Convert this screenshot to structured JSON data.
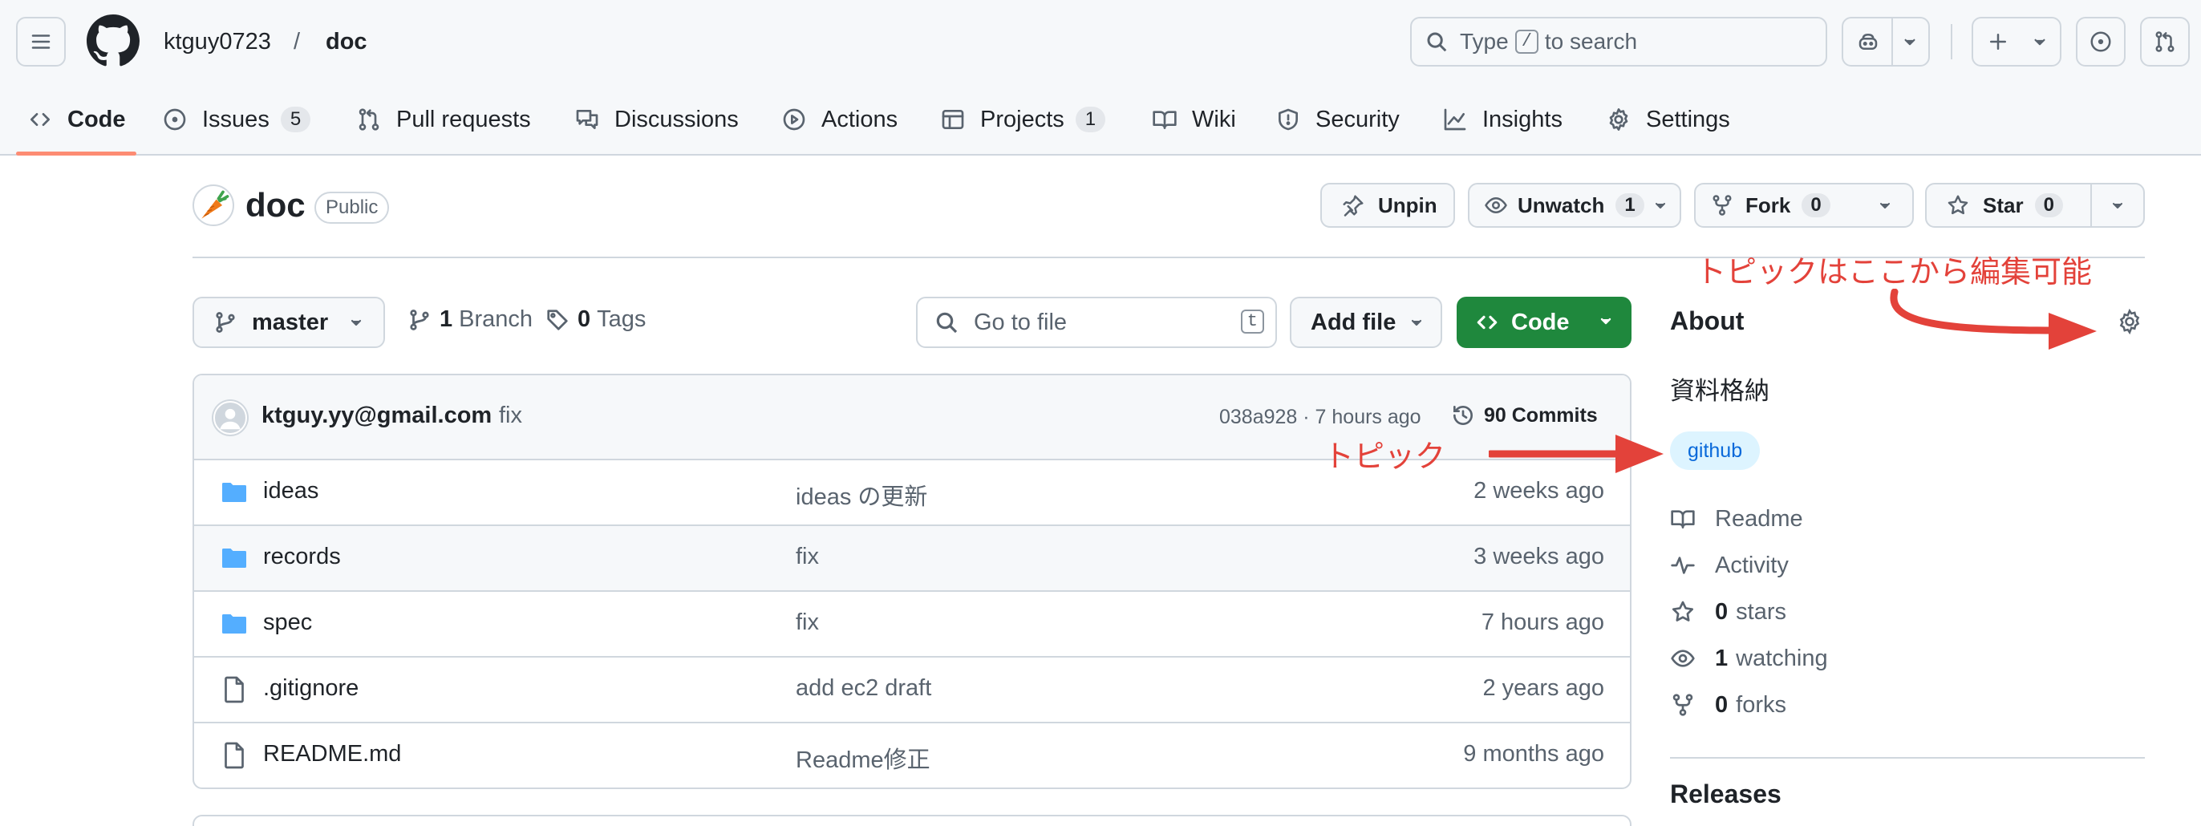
{
  "header": {
    "owner": "ktguy0723",
    "separator": "/",
    "repo": "doc",
    "search_prefix": "Type",
    "search_key": "/",
    "search_suffix": "to search"
  },
  "tabs": [
    {
      "label": "Code",
      "count": ""
    },
    {
      "label": "Issues",
      "count": "5"
    },
    {
      "label": "Pull requests",
      "count": ""
    },
    {
      "label": "Discussions",
      "count": ""
    },
    {
      "label": "Actions",
      "count": ""
    },
    {
      "label": "Projects",
      "count": "1"
    },
    {
      "label": "Wiki",
      "count": ""
    },
    {
      "label": "Security",
      "count": ""
    },
    {
      "label": "Insights",
      "count": ""
    },
    {
      "label": "Settings",
      "count": ""
    }
  ],
  "repo_header": {
    "name": "doc",
    "visibility": "Public",
    "unpin": "Unpin",
    "unwatch": "Unwatch",
    "watch_count": "1",
    "fork": "Fork",
    "fork_count": "0",
    "star": "Star",
    "star_count": "0"
  },
  "file_nav": {
    "branch": "master",
    "branch_count": "1",
    "branch_label": "Branch",
    "tag_count": "0",
    "tag_label": "Tags",
    "go_to_file": "Go to file",
    "go_to_file_key": "t",
    "add_file": "Add file",
    "code": "Code"
  },
  "commit": {
    "author": "ktguy.yy@gmail.com",
    "message": "fix",
    "meta": "038a928 · 7 hours ago",
    "commits": "90 Commits"
  },
  "files": [
    {
      "name": "ideas",
      "type": "dir",
      "message": "ideas の更新",
      "date": "2 weeks ago"
    },
    {
      "name": "records",
      "type": "dir",
      "message": "fix",
      "date": "3 weeks ago"
    },
    {
      "name": "spec",
      "type": "dir",
      "message": "fix",
      "date": "7 hours ago"
    },
    {
      "name": ".gitignore",
      "type": "file",
      "message": "add ec2 draft",
      "date": "2 years ago"
    },
    {
      "name": "README.md",
      "type": "file",
      "message": "Readme修正",
      "date": "9 months ago"
    }
  ],
  "about": {
    "title": "About",
    "description": "資料格納",
    "topic": "github",
    "readme": "Readme",
    "activity": "Activity",
    "stars_count": "0",
    "stars_label": "stars",
    "watching_count": "1",
    "watching_label": "watching",
    "forks_count": "0",
    "forks_label": "forks",
    "releases": "Releases"
  },
  "annotations": {
    "edit_note": "トピックはここから編集可能",
    "topic_note": "トピック",
    "color": "#e3423a"
  },
  "colors": {
    "accent_green": "#1f883d",
    "tab_underline": "#fd8c73",
    "folder": "#54aeff",
    "topic_bg": "#ddf4ff",
    "topic_text": "#0969da"
  }
}
